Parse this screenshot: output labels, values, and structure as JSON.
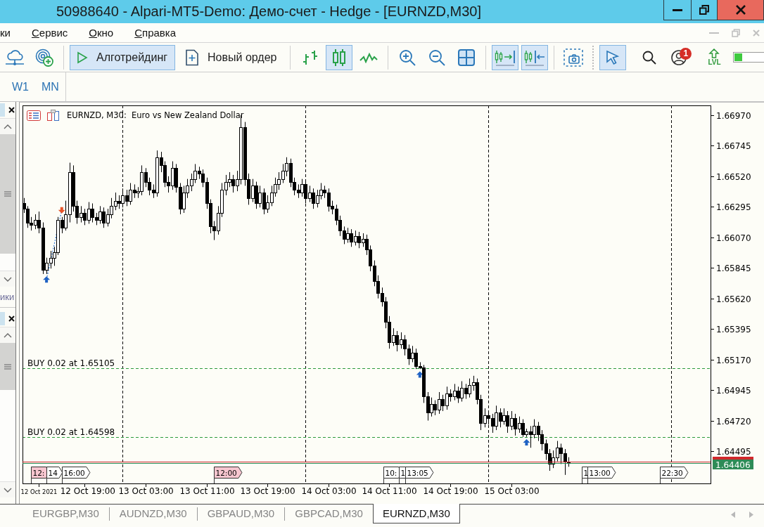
{
  "window": {
    "title": "50988640 - Alpari-MT5-Demo: Демо-счет - Hedge - [EURNZD,M30]"
  },
  "menu": {
    "items": [
      {
        "label": "ки",
        "mnemonic": false
      },
      {
        "label": "Сервис",
        "mnemonic": true
      },
      {
        "label": "Окно",
        "mnemonic": true
      },
      {
        "label": "Справка",
        "mnemonic": true
      }
    ]
  },
  "toolbar": {
    "items": [
      {
        "kind": "icon",
        "pressed": false
      },
      {
        "kind": "icon",
        "pressed": false
      },
      {
        "kind": "separator"
      },
      {
        "kind": "button",
        "label": "Алготрейдинг",
        "pressed": true
      },
      {
        "kind": "button",
        "label": "Новый ордер",
        "pressed": false
      },
      {
        "kind": "separator"
      },
      {
        "kind": "icon",
        "pressed": false
      },
      {
        "kind": "icon",
        "pressed": true
      },
      {
        "kind": "icon",
        "pressed": false
      },
      {
        "kind": "separator"
      },
      {
        "kind": "icon",
        "pressed": false
      },
      {
        "kind": "icon",
        "pressed": false
      },
      {
        "kind": "icon",
        "pressed": false
      },
      {
        "kind": "separator"
      },
      {
        "kind": "icon",
        "pressed": true
      },
      {
        "kind": "icon",
        "pressed": true
      },
      {
        "kind": "separator"
      },
      {
        "kind": "icon",
        "pressed": false
      },
      {
        "kind": "grip"
      },
      {
        "kind": "icon",
        "pressed": true
      },
      {
        "kind": "icon",
        "pressed": false
      },
      {
        "kind": "icon",
        "pressed": false,
        "badge": "1"
      },
      {
        "kind": "stacked",
        "label": "LVL",
        "pressed": false
      },
      {
        "kind": "meter",
        "level": 0.2
      }
    ]
  },
  "timeframes": [
    {
      "label": "W1",
      "selected": false
    },
    {
      "label": "MN",
      "selected": false
    }
  ],
  "dock": {
    "label": "ики"
  },
  "chart": {
    "chart_data": [
      {
        "type": "candlestick",
        "title": "EURNZD, M30:  Euro vs New Zealand Dollar",
        "x": [
          "2021-10-12T11:00",
          "2021-10-12T11:30",
          "2021-10-12T12:00",
          "2021-10-12T12:30",
          "2021-10-12T13:00",
          "2021-10-12T13:30",
          "2021-10-12T14:00",
          "2021-10-12T14:30",
          "2021-10-12T15:00",
          "2021-10-12T15:30",
          "2021-10-12T16:00",
          "2021-10-12T16:30",
          "2021-10-12T17:00",
          "2021-10-12T17:30",
          "2021-10-12T18:00",
          "2021-10-12T18:30",
          "2021-10-12T19:00",
          "2021-10-12T19:30",
          "2021-10-12T20:00",
          "2021-10-12T20:30",
          "2021-10-12T21:00",
          "2021-10-12T21:30",
          "2021-10-12T22:00",
          "2021-10-12T22:30",
          "2021-10-12T23:00",
          "2021-10-12T23:30",
          "2021-10-13T00:00",
          "2021-10-13T00:30",
          "2021-10-13T01:00",
          "2021-10-13T01:30",
          "2021-10-13T02:00",
          "2021-10-13T02:30",
          "2021-10-13T03:00",
          "2021-10-13T03:30",
          "2021-10-13T04:00",
          "2021-10-13T04:30",
          "2021-10-13T05:00",
          "2021-10-13T05:30",
          "2021-10-13T06:00",
          "2021-10-13T06:30",
          "2021-10-13T07:00",
          "2021-10-13T07:30",
          "2021-10-13T08:00",
          "2021-10-13T08:30",
          "2021-10-13T09:00",
          "2021-10-13T09:30",
          "2021-10-13T10:00",
          "2021-10-13T10:30",
          "2021-10-13T11:00",
          "2021-10-13T11:30",
          "2021-10-13T12:00",
          "2021-10-13T12:30",
          "2021-10-13T13:00",
          "2021-10-13T13:30",
          "2021-10-13T14:00",
          "2021-10-13T14:30",
          "2021-10-13T15:00",
          "2021-10-13T15:30",
          "2021-10-13T16:00",
          "2021-10-13T16:30",
          "2021-10-13T17:00",
          "2021-10-13T17:30",
          "2021-10-13T18:00",
          "2021-10-13T18:30",
          "2021-10-13T19:00",
          "2021-10-13T19:30",
          "2021-10-13T20:00",
          "2021-10-13T20:30",
          "2021-10-13T21:00",
          "2021-10-13T21:30",
          "2021-10-13T22:00",
          "2021-10-13T22:30",
          "2021-10-13T23:00",
          "2021-10-13T23:30",
          "2021-10-14T00:00",
          "2021-10-14T00:30",
          "2021-10-14T01:00",
          "2021-10-14T01:30",
          "2021-10-14T02:00",
          "2021-10-14T02:30",
          "2021-10-14T03:00",
          "2021-10-14T03:30",
          "2021-10-14T04:00",
          "2021-10-14T04:30",
          "2021-10-14T05:00",
          "2021-10-14T05:30",
          "2021-10-14T06:00",
          "2021-10-14T06:30",
          "2021-10-14T07:00",
          "2021-10-14T07:30",
          "2021-10-14T08:00",
          "2021-10-14T08:30",
          "2021-10-14T09:00",
          "2021-10-14T09:30",
          "2021-10-14T10:00",
          "2021-10-14T10:30",
          "2021-10-14T11:00",
          "2021-10-14T11:30",
          "2021-10-14T12:00",
          "2021-10-14T12:30",
          "2021-10-14T13:00",
          "2021-10-14T13:30",
          "2021-10-14T14:00",
          "2021-10-14T14:30",
          "2021-10-14T15:00",
          "2021-10-14T15:30",
          "2021-10-14T16:00",
          "2021-10-14T16:30",
          "2021-10-14T17:00",
          "2021-10-14T17:30",
          "2021-10-14T18:00",
          "2021-10-14T18:30",
          "2021-10-14T19:00",
          "2021-10-14T19:30",
          "2021-10-14T20:00",
          "2021-10-14T20:30",
          "2021-10-14T21:00",
          "2021-10-14T21:30",
          "2021-10-14T22:00",
          "2021-10-14T22:30",
          "2021-10-14T23:00",
          "2021-10-14T23:30",
          "2021-10-15T00:00",
          "2021-10-15T00:30",
          "2021-10-15T01:00",
          "2021-10-15T01:30",
          "2021-10-15T02:00",
          "2021-10-15T02:30",
          "2021-10-15T03:00",
          "2021-10-15T03:30",
          "2021-10-15T04:00",
          "2021-10-15T04:30",
          "2021-10-15T05:00",
          "2021-10-15T05:30",
          "2021-10-15T06:00",
          "2021-10-15T06:30",
          "2021-10-15T07:00",
          "2021-10-15T07:30",
          "2021-10-15T08:00",
          "2021-10-15T08:30",
          "2021-10-15T09:00",
          "2021-10-15T09:30",
          "2021-10-15T10:00",
          "2021-10-15T10:30"
        ],
        "ohlc": [
          [
            1.6632,
            1.6636,
            1.6625,
            1.6628
          ],
          [
            1.6628,
            1.663,
            1.6614,
            1.6618
          ],
          [
            1.6618,
            1.6622,
            1.6612,
            1.6616
          ],
          [
            1.6616,
            1.6624,
            1.6613,
            1.662
          ],
          [
            1.662,
            1.6626,
            1.661,
            1.6614
          ],
          [
            1.6614,
            1.6618,
            1.658,
            1.6583
          ],
          [
            1.6583,
            1.6592,
            1.658,
            1.6588
          ],
          [
            1.6588,
            1.6597,
            1.6584,
            1.6592
          ],
          [
            1.6592,
            1.66,
            1.6586,
            1.6596
          ],
          [
            1.6596,
            1.6622,
            1.6594,
            1.662
          ],
          [
            1.662,
            1.6622,
            1.661,
            1.6614
          ],
          [
            1.6614,
            1.6634,
            1.6612,
            1.6624
          ],
          [
            1.6624,
            1.6662,
            1.6618,
            1.6655
          ],
          [
            1.6655,
            1.666,
            1.6626,
            1.663
          ],
          [
            1.663,
            1.6634,
            1.6617,
            1.6622
          ],
          [
            1.6622,
            1.663,
            1.6618,
            1.6625
          ],
          [
            1.6625,
            1.6628,
            1.6616,
            1.662
          ],
          [
            1.662,
            1.6633,
            1.6617,
            1.6628
          ],
          [
            1.6628,
            1.6632,
            1.6618,
            1.6622
          ],
          [
            1.6622,
            1.6625,
            1.6616,
            1.662
          ],
          [
            1.662,
            1.663,
            1.6617,
            1.6626
          ],
          [
            1.6626,
            1.6629,
            1.6614,
            1.6618
          ],
          [
            1.6618,
            1.6628,
            1.6615,
            1.6624
          ],
          [
            1.6624,
            1.6636,
            1.6621,
            1.663
          ],
          [
            1.663,
            1.664,
            1.6627,
            1.6634
          ],
          [
            1.6634,
            1.6638,
            1.6628,
            1.6632
          ],
          [
            1.6632,
            1.6643,
            1.6629,
            1.6638
          ],
          [
            1.6638,
            1.6642,
            1.663,
            1.6634
          ],
          [
            1.6634,
            1.6647,
            1.6631,
            1.6642
          ],
          [
            1.6642,
            1.6646,
            1.6636,
            1.664
          ],
          [
            1.664,
            1.6644,
            1.6636,
            1.6641
          ],
          [
            1.6641,
            1.666,
            1.6638,
            1.6655
          ],
          [
            1.6655,
            1.6658,
            1.6644,
            1.6648
          ],
          [
            1.6648,
            1.6651,
            1.6638,
            1.6642
          ],
          [
            1.6642,
            1.6646,
            1.6636,
            1.664
          ],
          [
            1.664,
            1.6671,
            1.6637,
            1.6666
          ],
          [
            1.6666,
            1.667,
            1.6655,
            1.666
          ],
          [
            1.666,
            1.6663,
            1.6644,
            1.6648
          ],
          [
            1.6648,
            1.6652,
            1.664,
            1.6645
          ],
          [
            1.6645,
            1.6663,
            1.6642,
            1.6658
          ],
          [
            1.6658,
            1.6661,
            1.664,
            1.6644
          ],
          [
            1.6644,
            1.6647,
            1.6624,
            1.6628
          ],
          [
            1.6628,
            1.6645,
            1.6625,
            1.664
          ],
          [
            1.664,
            1.665,
            1.6636,
            1.6645
          ],
          [
            1.6645,
            1.6654,
            1.6641,
            1.665
          ],
          [
            1.665,
            1.6661,
            1.6647,
            1.6656
          ],
          [
            1.6656,
            1.6659,
            1.665,
            1.6654
          ],
          [
            1.6654,
            1.6657,
            1.6644,
            1.6648
          ],
          [
            1.6648,
            1.6651,
            1.6628,
            1.6632
          ],
          [
            1.6632,
            1.6635,
            1.661,
            1.6615
          ],
          [
            1.6615,
            1.6619,
            1.6605,
            1.6612
          ],
          [
            1.6612,
            1.663,
            1.6609,
            1.6625
          ],
          [
            1.6625,
            1.6647,
            1.6622,
            1.6642
          ],
          [
            1.6642,
            1.6653,
            1.6638,
            1.6648
          ],
          [
            1.6648,
            1.6655,
            1.6644,
            1.665
          ],
          [
            1.665,
            1.6653,
            1.664,
            1.6645
          ],
          [
            1.6645,
            1.6656,
            1.6641,
            1.665
          ],
          [
            1.665,
            1.6697,
            1.6646,
            1.6688
          ],
          [
            1.6688,
            1.6692,
            1.6645,
            1.665
          ],
          [
            1.665,
            1.6654,
            1.6631,
            1.6636
          ],
          [
            1.6636,
            1.665,
            1.6633,
            1.6645
          ],
          [
            1.6645,
            1.6648,
            1.6628,
            1.6632
          ],
          [
            1.6632,
            1.6645,
            1.6629,
            1.664
          ],
          [
            1.664,
            1.6643,
            1.6624,
            1.6628
          ],
          [
            1.6628,
            1.6638,
            1.6625,
            1.6633
          ],
          [
            1.6633,
            1.6645,
            1.663,
            1.664
          ],
          [
            1.664,
            1.6651,
            1.6637,
            1.6646
          ],
          [
            1.6646,
            1.6655,
            1.6642,
            1.665
          ],
          [
            1.665,
            1.6661,
            1.6647,
            1.6656
          ],
          [
            1.6656,
            1.6666,
            1.6652,
            1.6662
          ],
          [
            1.6662,
            1.6665,
            1.6644,
            1.6648
          ],
          [
            1.6648,
            1.6651,
            1.6638,
            1.6642
          ],
          [
            1.6642,
            1.6646,
            1.6636,
            1.664
          ],
          [
            1.664,
            1.665,
            1.6637,
            1.6646
          ],
          [
            1.6646,
            1.6649,
            1.6632,
            1.6636
          ],
          [
            1.6636,
            1.6645,
            1.6633,
            1.664
          ],
          [
            1.664,
            1.6643,
            1.6628,
            1.6632
          ],
          [
            1.6632,
            1.6642,
            1.6629,
            1.6638
          ],
          [
            1.6638,
            1.6647,
            1.6635,
            1.6642
          ],
          [
            1.6642,
            1.6645,
            1.6636,
            1.664
          ],
          [
            1.664,
            1.6643,
            1.6626,
            1.663
          ],
          [
            1.663,
            1.6634,
            1.6624,
            1.6628
          ],
          [
            1.6628,
            1.6631,
            1.6616,
            1.662
          ],
          [
            1.662,
            1.6623,
            1.6608,
            1.6612
          ],
          [
            1.6612,
            1.6615,
            1.6602,
            1.6606
          ],
          [
            1.6606,
            1.6614,
            1.6603,
            1.661
          ],
          [
            1.661,
            1.6613,
            1.66,
            1.6604
          ],
          [
            1.6604,
            1.6612,
            1.6601,
            1.6608
          ],
          [
            1.6608,
            1.6611,
            1.6599,
            1.6603
          ],
          [
            1.6603,
            1.661,
            1.66,
            1.6606
          ],
          [
            1.6606,
            1.6609,
            1.6594,
            1.6598
          ],
          [
            1.6598,
            1.6601,
            1.6582,
            1.6586
          ],
          [
            1.6586,
            1.659,
            1.6571,
            1.6575
          ],
          [
            1.6575,
            1.6579,
            1.6562,
            1.6566
          ],
          [
            1.6566,
            1.657,
            1.6556,
            1.656
          ],
          [
            1.656,
            1.6563,
            1.654,
            1.6545
          ],
          [
            1.6545,
            1.6549,
            1.6525,
            1.653
          ],
          [
            1.653,
            1.654,
            1.6527,
            1.6535
          ],
          [
            1.6535,
            1.6538,
            1.6523,
            1.6528
          ],
          [
            1.6528,
            1.6537,
            1.6525,
            1.6532
          ],
          [
            1.6532,
            1.6535,
            1.652,
            1.6525
          ],
          [
            1.6525,
            1.6528,
            1.6513,
            1.6518
          ],
          [
            1.6518,
            1.6527,
            1.6515,
            1.6522
          ],
          [
            1.6522,
            1.6525,
            1.651,
            1.6512
          ],
          [
            1.6512,
            1.6515,
            1.651,
            1.6511
          ],
          [
            1.6511,
            1.6513,
            1.6485,
            1.649
          ],
          [
            1.649,
            1.6493,
            1.6472,
            1.6478
          ],
          [
            1.6478,
            1.6489,
            1.6475,
            1.6484
          ],
          [
            1.6484,
            1.6487,
            1.6476,
            1.648
          ],
          [
            1.648,
            1.6493,
            1.6477,
            1.6488
          ],
          [
            1.6488,
            1.6491,
            1.6479,
            1.6483
          ],
          [
            1.6483,
            1.6497,
            1.648,
            1.6492
          ],
          [
            1.6492,
            1.6495,
            1.6486,
            1.649
          ],
          [
            1.649,
            1.6499,
            1.6487,
            1.6494
          ],
          [
            1.6494,
            1.6497,
            1.6485,
            1.6489
          ],
          [
            1.6489,
            1.6501,
            1.6486,
            1.6496
          ],
          [
            1.6496,
            1.6499,
            1.6488,
            1.6492
          ],
          [
            1.6492,
            1.6503,
            1.6489,
            1.6498
          ],
          [
            1.6498,
            1.6505,
            1.6494,
            1.65
          ],
          [
            1.65,
            1.6503,
            1.6484,
            1.6488
          ],
          [
            1.6488,
            1.6491,
            1.6465,
            1.647
          ],
          [
            1.647,
            1.6481,
            1.6467,
            1.6476
          ],
          [
            1.6476,
            1.6479,
            1.6469,
            1.6474
          ],
          [
            1.6474,
            1.6477,
            1.6463,
            1.6468
          ],
          [
            1.6468,
            1.6483,
            1.6465,
            1.6478
          ],
          [
            1.6478,
            1.6481,
            1.6467,
            1.6472
          ],
          [
            1.6472,
            1.6481,
            1.6469,
            1.6476
          ],
          [
            1.6476,
            1.6479,
            1.6463,
            1.6468
          ],
          [
            1.6468,
            1.6479,
            1.6465,
            1.6474
          ],
          [
            1.6474,
            1.6477,
            1.6461,
            1.6466
          ],
          [
            1.6466,
            1.6475,
            1.6463,
            1.647
          ],
          [
            1.647,
            1.6473,
            1.646,
            1.6462
          ],
          [
            1.6462,
            1.6466,
            1.646,
            1.6464
          ],
          [
            1.6464,
            1.6468,
            1.6452,
            1.6462
          ],
          [
            1.6462,
            1.6473,
            1.6459,
            1.6468
          ],
          [
            1.6468,
            1.6471,
            1.6457,
            1.6462
          ],
          [
            1.6462,
            1.6465,
            1.645,
            1.6455
          ],
          [
            1.6455,
            1.6458,
            1.6443,
            1.6448
          ],
          [
            1.6448,
            1.6451,
            1.6435,
            1.644
          ],
          [
            1.644,
            1.645,
            1.6437,
            1.6445
          ],
          [
            1.6445,
            1.6457,
            1.6442,
            1.6452
          ],
          [
            1.6452,
            1.6455,
            1.644,
            1.6448
          ],
          [
            1.6448,
            1.6451,
            1.6432,
            1.6442
          ],
          [
            1.6442,
            1.6445,
            1.6438,
            1.6441
          ]
        ],
        "xlim": [
          "2021-10-12T10:51",
          "2021-10-16T05:09"
        ],
        "ylim": [
          1.64257,
          1.67042
        ],
        "xticks": [
          {
            "value": "2021-10-12T13:00",
            "label": "12 Oct 2021"
          },
          {
            "value": "2021-10-12T19:00",
            "label": "12 Oct 19:00"
          },
          {
            "value": "2021-10-13T03:00",
            "label": "13 Oct 03:00"
          },
          {
            "value": "2021-10-13T11:00",
            "label": "13 Oct 11:00"
          },
          {
            "value": "2021-10-13T19:00",
            "label": "13 Oct 19:00"
          },
          {
            "value": "2021-10-14T03:00",
            "label": "14 Oct 03:00"
          },
          {
            "value": "2021-10-14T11:00",
            "label": "14 Oct 11:00"
          },
          {
            "value": "2021-10-14T19:00",
            "label": "14 Oct 19:00"
          },
          {
            "value": "2021-10-15T03:00",
            "label": "15 Oct 03:00"
          }
        ],
        "yticks": [
          {
            "value": 1.6697,
            "label": "1.66970"
          },
          {
            "value": 1.66745,
            "label": "1.66745"
          },
          {
            "value": 1.6652,
            "label": "1.66520"
          },
          {
            "value": 1.66295,
            "label": "1.66295"
          },
          {
            "value": 1.6607,
            "label": "1.66070"
          },
          {
            "value": 1.65845,
            "label": "1.65845"
          },
          {
            "value": 1.6562,
            "label": "1.65620"
          },
          {
            "value": 1.65395,
            "label": "1.65395"
          },
          {
            "value": 1.6517,
            "label": "1.65170"
          },
          {
            "value": 1.64945,
            "label": "1.64945"
          },
          {
            "value": 1.6472,
            "label": "1.64720"
          },
          {
            "value": 1.64495,
            "label": "1.64495"
          }
        ],
        "series": [
          {
            "type": "line",
            "line_style": "dotted",
            "color": "#3b7dd8",
            "x": [
              "2021-10-12T14:00",
              "2021-10-12T16:00"
            ],
            "values": [
              1.6576,
              1.6627
            ]
          },
          {
            "type": "scatter",
            "color": "#1f62c4",
            "x": [
              "2021-10-12T14:00",
              "2021-10-14T15:00",
              "2021-10-15T05:00"
            ],
            "values": [
              1.6576,
              1.6506,
              1.6456
            ]
          },
          {
            "type": "scatter",
            "color": "#e8542a",
            "x": [
              "2021-10-12T16:00"
            ],
            "values": [
              1.6627
            ]
          }
        ],
        "ref_lines": [
          {
            "axis": "x",
            "value": "2021-10-13T00:00",
            "color": "#000000",
            "line_style": "dashed"
          },
          {
            "axis": "x",
            "value": "2021-10-14T00:00",
            "color": "#000000",
            "line_style": "dashed"
          },
          {
            "axis": "x",
            "value": "2021-10-15T00:00",
            "color": "#000000",
            "line_style": "dashed"
          },
          {
            "axis": "x",
            "value": "2021-10-16T00:00",
            "color": "#000000",
            "line_style": "dashed"
          },
          {
            "axis": "y",
            "value": 1.65105,
            "label": "BUY 0.02 at 1.65105",
            "color": "#2b9a3c",
            "line_style": "dashed"
          },
          {
            "axis": "y",
            "value": 1.64598,
            "label": "BUY 0.02 at 1.64598",
            "color": "#2b9a3c",
            "line_style": "dashed"
          },
          {
            "axis": "y",
            "value": 1.6442,
            "color": "#d0282c"
          },
          {
            "axis": "y",
            "value": 1.64406,
            "label": "1.64406",
            "color": "#2e8b57"
          },
          {
            "axis": "x",
            "value": "2021-10-12T12:00",
            "label": "12:",
            "color": "#333333"
          },
          {
            "axis": "x",
            "value": "2021-10-12T14:00",
            "label": "14",
            "color": "#333333"
          },
          {
            "axis": "x",
            "value": "2021-10-12T16:00",
            "label": "16:00",
            "color": "#333333"
          },
          {
            "axis": "x",
            "value": "2021-10-13T12:00",
            "label": "12:00",
            "color": "#333333"
          },
          {
            "axis": "x",
            "value": "2021-10-14T10:15",
            "label": "10:",
            "color": "#333333"
          },
          {
            "axis": "x",
            "value": "2021-10-14T12:15",
            "label": "1",
            "color": "#333333"
          },
          {
            "axis": "x",
            "value": "2021-10-14T13:05",
            "label": "13:05",
            "color": "#333333"
          },
          {
            "axis": "x",
            "value": "2021-10-15T12:15",
            "label": "1",
            "color": "#333333"
          },
          {
            "axis": "x",
            "value": "2021-10-15T13:00",
            "label": "13:00",
            "color": "#333333"
          },
          {
            "axis": "x",
            "value": "2021-10-15T22:30",
            "label": "22:30",
            "color": "#333333"
          }
        ]
      }
    ],
    "event_flags": [
      {
        "color": "#f7c6d0"
      },
      {
        "color": "#ffffff"
      },
      {
        "color": "#ffffff"
      },
      {
        "color": "#f7c6d0"
      },
      {
        "color": "#ffffff"
      },
      {
        "color": "#ffffff"
      },
      {
        "color": "#ffffff"
      },
      {
        "color": "#ffffff"
      },
      {
        "color": "#ffffff"
      },
      {
        "color": "#ffffff"
      }
    ]
  },
  "tabs": [
    {
      "label": "EURGBP,M30",
      "selected": false
    },
    {
      "label": "AUDNZD,M30",
      "selected": false
    },
    {
      "label": "GBPAUD,M30",
      "selected": false
    },
    {
      "label": "GBPCAD,M30",
      "selected": false
    },
    {
      "label": "EURNZD,M30",
      "selected": true
    }
  ]
}
